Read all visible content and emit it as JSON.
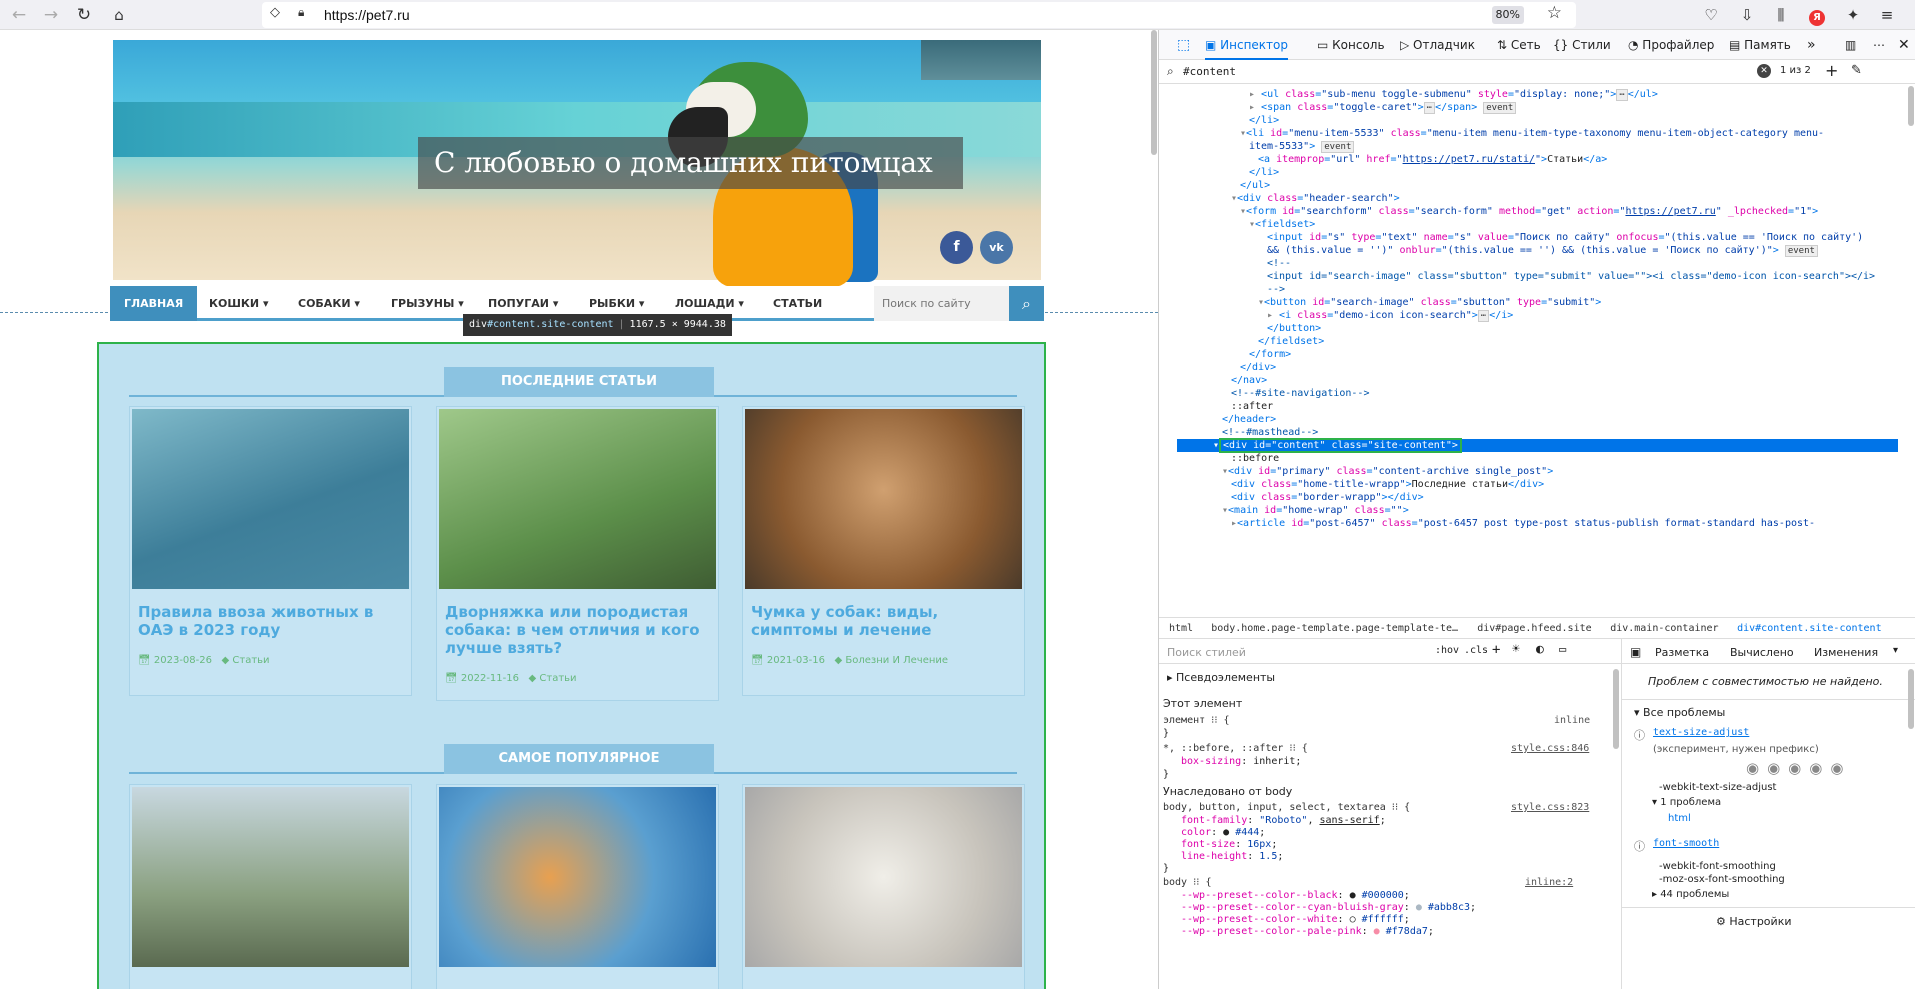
{
  "browser": {
    "url": "https://pet7.ru",
    "zoom": "80%"
  },
  "site": {
    "header_title": "С любовью о домашних питомцах",
    "social": [
      "f",
      "vk"
    ],
    "nav": [
      "ГЛАВНАЯ",
      "КОШКИ",
      "СОБАКИ",
      "ГРЫЗУНЫ",
      "ПОПУГАИ",
      "РЫБКИ",
      "ЛОШАДИ",
      "СТАТЬИ"
    ],
    "search_placeholder": "Поиск по сайту",
    "tooltip": {
      "tag": "div",
      "id": "#content",
      "cls": ".site-content",
      "size": "1167.5 × 9944.38"
    },
    "section1": "ПОСЛЕДНИЕ СТАТЬИ",
    "section2": "САМОЕ ПОПУЛЯРНОЕ",
    "cards": [
      {
        "title": "Правила ввоза животных в ОАЭ в 2023 году",
        "date": "2023-08-26",
        "cat": "Статьи"
      },
      {
        "title": "Дворняжка или породистая собака: в чем отличия и кого лучше взять?",
        "date": "2022-11-16",
        "cat": "Статьи"
      },
      {
        "title": "Чумка у собак: виды, симптомы и лечение",
        "date": "2021-03-16",
        "cat": "Болезни И Лечение"
      }
    ]
  },
  "devtools": {
    "tabs": [
      "Инспектор",
      "Консоль",
      "Отладчик",
      "Сеть",
      "Стили",
      "Профайлер",
      "Память"
    ],
    "search": "#content",
    "match": "1 из 2",
    "code": [
      {
        "ind": 8,
        "html": "<span class='k'>▸</span> &lt;ul <span class='a'>class</span>=<span class='v'>\"sub-menu toggle-submenu\"</span> <span class='a'>style</span>=<span class='v'>\"display: none;\"</span>&gt;<span class='e'>⋯</span>&lt;/ul&gt;"
      },
      {
        "ind": 8,
        "html": "<span class='k'>▸</span> &lt;span <span class='a'>class</span>=<span class='v'>\"toggle-caret\"</span>&gt;<span class='e'>⋯</span>&lt;/span&gt; <span class='e'>event</span>"
      },
      {
        "ind": 8,
        "html": "&lt;/li&gt;"
      },
      {
        "ind": 7,
        "html": "<span class='k'>▾</span>&lt;li <span class='a'>id</span>=<span class='v'>\"menu-item-5533\"</span> <span class='a'>class</span>=<span class='v'>\"menu-item menu-item-type-taxonomy menu-item-object-category menu-</span>"
      },
      {
        "ind": 8,
        "html": "<span class='v'>item-5533\"</span>&gt; <span class='e'>event</span>"
      },
      {
        "ind": 9,
        "html": "&lt;a <span class='a'>itemprop</span>=<span class='v'>\"url\"</span> <span class='a'>href</span>=<span class='v'>\"<u>https://pet7.ru/stati/</u>\"</span>&gt;<span class='x'>Статьи</span>&lt;/a&gt;"
      },
      {
        "ind": 8,
        "html": "&lt;/li&gt;"
      },
      {
        "ind": 7,
        "html": "&lt;/ul&gt;"
      },
      {
        "ind": 6,
        "html": "<span class='k'>▾</span>&lt;div <span class='a'>class</span>=<span class='v'>\"header-search\"</span>&gt;"
      },
      {
        "ind": 7,
        "html": "<span class='k'>▾</span>&lt;form <span class='a'>id</span>=<span class='v'>\"searchform\"</span> <span class='a'>class</span>=<span class='v'>\"search-form\"</span> <span class='a'>method</span>=<span class='v'>\"get\"</span> <span class='a'>action</span>=<span class='v'>\"<u>https://pet7.ru</u>\"</span> <span class='a'>_lpchecked</span>=<span class='v'>\"1\"</span>&gt;"
      },
      {
        "ind": 8,
        "html": "<span class='k'>▾</span>&lt;fieldset&gt;"
      },
      {
        "ind": 10,
        "html": "&lt;input <span class='a'>id</span>=<span class='v'>\"s\"</span> <span class='a'>type</span>=<span class='v'>\"text\"</span> <span class='a'>name</span>=<span class='v'>\"s\"</span> <span class='a'>value</span>=<span class='v'>\"Поиск по сайту\"</span> <span class='a'>onfocus</span>=<span class='v'>\"(this.value == 'Поиск по сайту')</span>"
      },
      {
        "ind": 10,
        "html": "<span class='v'>&amp;&amp; (this.value = '')\"</span> <span class='a'>onblur</span>=<span class='v'>\"(this.value == '') &amp;&amp; (this.value = 'Поиск по сайту')\"</span>&gt; <span class='e'>event</span>"
      },
      {
        "ind": 10,
        "html": "<span class='c'>&lt;!--</span>"
      },
      {
        "ind": 10,
        "html": "<span class='c'>&lt;input id=\"search-image\" class=\"sbutton\" type=\"submit\" value=\"\"&gt;&lt;i class=\"demo-icon icon-search\"&gt;&lt;/i&gt;</span>"
      },
      {
        "ind": 10,
        "html": "<span class='c'>--&gt;</span>"
      },
      {
        "ind": 9,
        "html": "<span class='k'>▾</span>&lt;button <span class='a'>id</span>=<span class='v'>\"search-image\"</span> <span class='a'>class</span>=<span class='v'>\"sbutton\"</span> <span class='a'>type</span>=<span class='v'>\"submit\"</span>&gt;"
      },
      {
        "ind": 10,
        "html": "<span class='k'>▸</span> &lt;i <span class='a'>class</span>=<span class='v'>\"demo-icon icon-search\"</span>&gt;<span class='e'>⋯</span>&lt;/i&gt;"
      },
      {
        "ind": 10,
        "html": "&lt;/button&gt;"
      },
      {
        "ind": 9,
        "html": "&lt;/fieldset&gt;"
      },
      {
        "ind": 8,
        "html": "&lt;/form&gt;"
      },
      {
        "ind": 7,
        "html": "&lt;/div&gt;"
      },
      {
        "ind": 6,
        "html": "&lt;/nav&gt;"
      },
      {
        "ind": 6,
        "html": "<span class='c'>&lt;!--#site-navigation--&gt;</span>"
      },
      {
        "ind": 6,
        "html": "<span class='x'>::after</span>"
      },
      {
        "ind": 5,
        "html": "&lt;/header&gt;"
      },
      {
        "ind": 5,
        "html": "<span class='c'>&lt;!--#masthead--&gt;</span>"
      },
      {
        "ind": 4,
        "sel": true,
        "html": "<span class='k' style='color:#fff'>▾</span><span class='selbox'>&lt;div <span class='a'>id</span>=<span class='v'>\"content\"</span> <span class='a'>class</span>=<span class='v'>\"site-content\"</span>&gt;</span>"
      },
      {
        "ind": 6,
        "html": "<span class='x'>::before</span>"
      },
      {
        "ind": 5,
        "html": "<span class='k'>▾</span>&lt;div <span class='a'>id</span>=<span class='v'>\"primary\"</span> <span class='a'>class</span>=<span class='v'>\"content-archive single_post\"</span>&gt;"
      },
      {
        "ind": 6,
        "html": "&lt;div <span class='a'>class</span>=<span class='v'>\"home-title-wrapp\"</span>&gt;<span class='x'>Последние статьи</span>&lt;/div&gt;"
      },
      {
        "ind": 6,
        "html": "&lt;div <span class='a'>class</span>=<span class='v'>\"border-wrapp\"</span>&gt;&lt;/div&gt;"
      },
      {
        "ind": 5,
        "html": "<span class='k'>▾</span>&lt;main <span class='a'>id</span>=<span class='v'>\"home-wrap\"</span> <span class='a'>class</span>=<span class='v'>\"\"</span>&gt;"
      },
      {
        "ind": 6,
        "html": "<span class='k'>▸</span>&lt;article <span class='a'>id</span>=<span class='v'>\"post-6457\"</span> <span class='a'>class</span>=<span class='v'>\"post-6457 post type-post status-publish format-standard has-post-</span>"
      }
    ],
    "breadcrumbs": [
      "html",
      "body.home.page-template.page-template-te…",
      "div#page.hfeed.site",
      "div.main-container",
      "div#content.site-content"
    ],
    "rules_filter": "Поиск стилей",
    "side_tabs": [
      "Разметка",
      "Вычислено",
      "Изменения"
    ],
    "side_msg": "Проблем с совместимостью не найдено.",
    "settings": "Настройки"
  }
}
